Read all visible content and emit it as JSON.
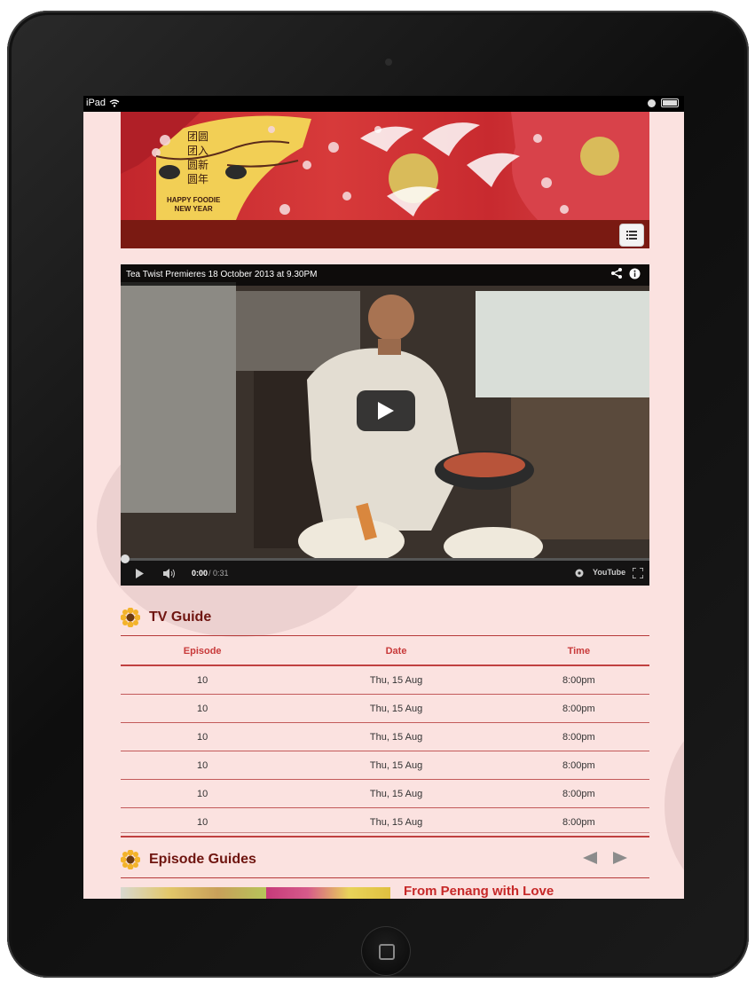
{
  "device": {
    "label": "iPad"
  },
  "video": {
    "title": "Tea Twist Premieres 18 October 2013 at 9.30PM",
    "time_current": "0:00",
    "time_total": "/ 0:31",
    "brand": "YouTube"
  },
  "tv_guide": {
    "heading": "TV Guide",
    "columns": [
      "Episode",
      "Date",
      "Time"
    ],
    "rows": [
      {
        "episode": "10",
        "date": "Thu, 15 Aug",
        "time": "8:00pm"
      },
      {
        "episode": "10",
        "date": "Thu, 15 Aug",
        "time": "8:00pm"
      },
      {
        "episode": "10",
        "date": "Thu, 15 Aug",
        "time": "8:00pm"
      },
      {
        "episode": "10",
        "date": "Thu, 15 Aug",
        "time": "8:00pm"
      },
      {
        "episode": "10",
        "date": "Thu, 15 Aug",
        "time": "8:00pm"
      },
      {
        "episode": "10",
        "date": "Thu, 15 Aug",
        "time": "8:00pm"
      }
    ]
  },
  "episode_guides": {
    "heading": "Episode Guides",
    "first_title": "From Penang with Love",
    "prev_icon": "arrow-left-icon",
    "next_icon": "arrow-right-icon"
  },
  "banner": {
    "chinese_lines": [
      "团圆",
      "团入",
      "圆新",
      "圆年"
    ],
    "tagline_line1": "HAPPY FOODIE",
    "tagline_line2": "NEW YEAR"
  },
  "colors": {
    "brand_red": "#c62828",
    "nav_dark": "#7a1a12",
    "page_bg": "#fbe2e0"
  }
}
